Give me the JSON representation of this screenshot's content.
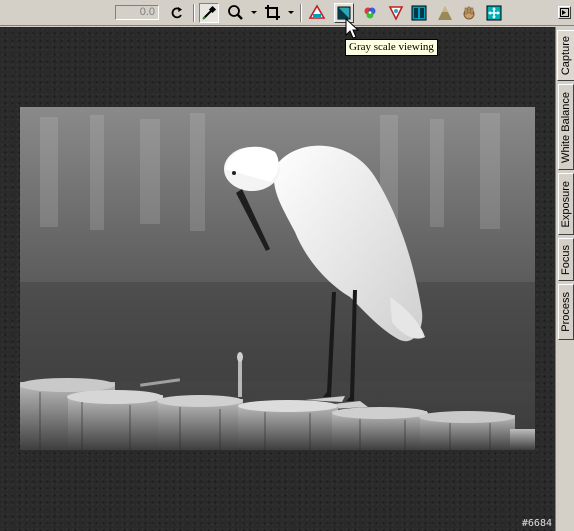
{
  "toolbar": {
    "value_display": "0.0",
    "buttons": [
      {
        "name": "rotate-button",
        "icon": "rotate-icon"
      },
      {
        "name": "eyedropper-button",
        "icon": "eyedropper-icon",
        "state": "pressed"
      },
      {
        "name": "zoom-button",
        "icon": "magnifier-icon"
      },
      {
        "name": "crop-button",
        "icon": "crop-icon"
      },
      {
        "name": "highlight-warning-button",
        "icon": "highlight-warning-icon"
      },
      {
        "name": "grayscale-view-button",
        "icon": "grayscale-icon",
        "state": "hot"
      },
      {
        "name": "color-wheel-button",
        "icon": "color-wheel-icon"
      },
      {
        "name": "shadow-warning-button",
        "icon": "shadow-warning-icon"
      },
      {
        "name": "compare-view-button",
        "icon": "split-view-icon"
      },
      {
        "name": "fit-button",
        "icon": "mountain-icon"
      },
      {
        "name": "hand-tool-button",
        "icon": "hand-icon"
      },
      {
        "name": "navigator-button",
        "icon": "navigator-icon"
      }
    ]
  },
  "tooltip": {
    "text": "Gray scale viewing"
  },
  "tabs": [
    {
      "label": "Capture",
      "active": true
    },
    {
      "label": "White Balance",
      "active": false
    },
    {
      "label": "Exposure",
      "active": false
    },
    {
      "label": "Focus",
      "active": false
    },
    {
      "label": "Process",
      "active": false
    }
  ],
  "viewer": {
    "frame_counter": "#6684"
  },
  "photo": {
    "subject": "egret-on-posts",
    "mode": "grayscale"
  },
  "colors": {
    "chrome": "#d4d0c8",
    "viewer_bg": "#2a2a2a",
    "tooltip_bg": "#ffffe1"
  }
}
